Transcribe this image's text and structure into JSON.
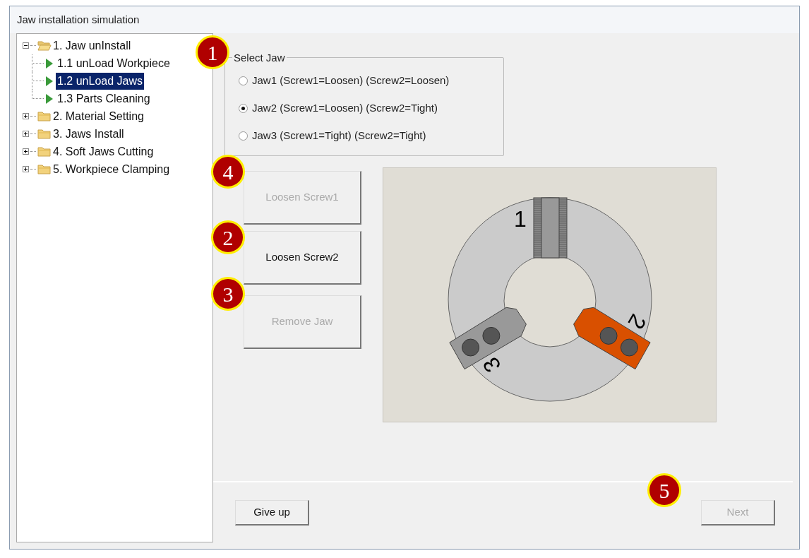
{
  "window": {
    "title": "Jaw installation simulation"
  },
  "tree": [
    {
      "label": "1. Jaw unInstall",
      "expanded": true,
      "selected": false,
      "children": [
        {
          "label": "1.1 unLoad Workpiece",
          "selected": false
        },
        {
          "label": "1.2 unLoad Jaws",
          "selected": true
        },
        {
          "label": "1.3 Parts Cleaning",
          "selected": false
        }
      ]
    },
    {
      "label": "2. Material Setting",
      "expanded": false,
      "selected": false
    },
    {
      "label": "3. Jaws Install",
      "expanded": false,
      "selected": false
    },
    {
      "label": "4. Soft Jaws Cutting",
      "expanded": false,
      "selected": false
    },
    {
      "label": "5. Workpiece Clamping",
      "expanded": false,
      "selected": false
    }
  ],
  "select_jaw": {
    "title": "Select Jaw",
    "options": [
      {
        "label": "Jaw1 (Screw1=Loosen) (Screw2=Loosen)",
        "selected": false
      },
      {
        "label": "Jaw2 (Screw1=Loosen) (Screw2=Tight)",
        "selected": true
      },
      {
        "label": "Jaw3 (Screw1=Tight) (Screw2=Tight)",
        "selected": false
      }
    ]
  },
  "actions": [
    {
      "label": "Loosen Screw1",
      "disabled": true
    },
    {
      "label": "Loosen Screw2",
      "disabled": false
    },
    {
      "label": "Remove Jaw",
      "disabled": true
    }
  ],
  "chuck": {
    "jaws": [
      {
        "label": "1",
        "color": "#999999"
      },
      {
        "label": "2",
        "color": "#d95000"
      },
      {
        "label": "3",
        "color": "#999999"
      }
    ]
  },
  "footer": {
    "buttons": [
      {
        "label": "Give up",
        "disabled": false
      },
      {
        "label": "Next",
        "disabled": true
      }
    ]
  },
  "callouts": [
    "1",
    "4",
    "2",
    "3",
    "5"
  ]
}
